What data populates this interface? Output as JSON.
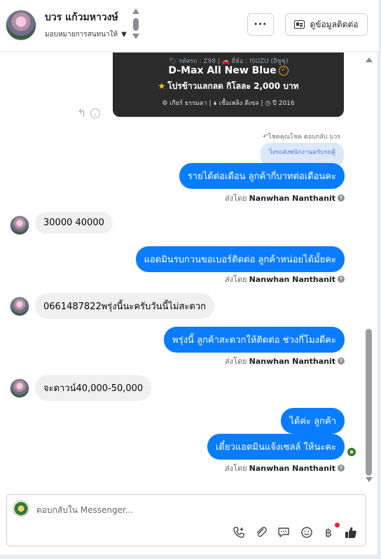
{
  "header": {
    "contact_name": "บวร แก้วมหาวงษ์",
    "assignee_label": "มอบหมายการสนทนาให้",
    "more_label": "···",
    "contact_info_label": "ดูข้อมูลติดต่อ"
  },
  "product_card": {
    "sub_meta": "🏷 รหัสรถ : Z98 | 🚗 ยี่ห้อ : ISUZU (อีซูซุ)",
    "title": "D-Max All New Blue",
    "price": "โปรข้าวแลกลด กิโลละ 2,000 บาท",
    "specs": "⚙ เกียร์ ธรรมดา  |  🌢 เชื้อเพลิง ดีเซล  |  ◷ ปี 2016"
  },
  "thread": {
    "reply_context": "↶โชคคุณโชค ตอบกลับ บวร",
    "quoted_text": "วิ่งรถส่งพนักงานครับรถตู้",
    "sent_by_prefix": "ส่งโดย",
    "sender_name": "Nanwhan Nanthanit",
    "messages": {
      "out1": "รายได้ต่อเดือน ลูกค้ากี่บาทต่อเดือนคะ",
      "in1": "30000  40000",
      "out2": "แอดมินรบกวนขอเบอร์ติดต่อ ลูกค้าหน่อยได้มั้ยคะ",
      "in2": "0661487822พรุ่งนี้นะครับวันนี้ไม่สะดวก",
      "out3": "พรุ่งนี้ ลูกค้าสะดวกให้ติดต่อ ช่วงกี่โมงดีคะ",
      "in3": "จะดาวน์40,000-50,000",
      "out4": "ได้ค่ะ  ลูกค้า",
      "out5": "เดี๋ยวแอดมินแจ้งเซลล์ ให้นะคะ"
    }
  },
  "composer": {
    "placeholder": "ตอบกลับใน Messenger..."
  },
  "colors": {
    "outgoing_bubble": "#0a7cff",
    "incoming_bubble": "#f0f0f0",
    "product_card_bg": "#2b2b2b"
  }
}
